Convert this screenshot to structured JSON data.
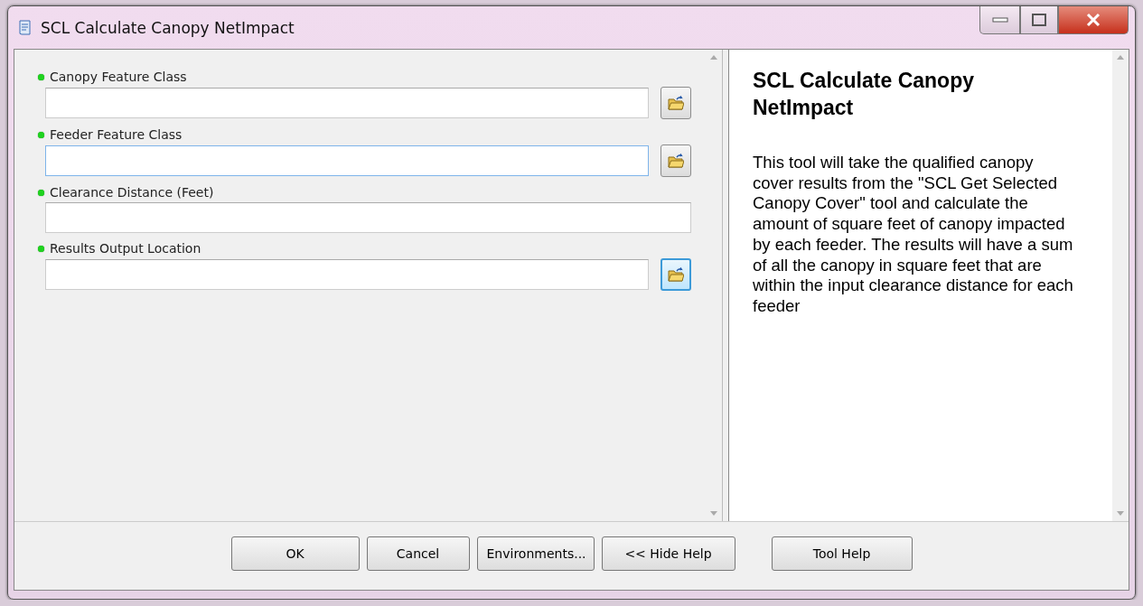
{
  "window": {
    "title": "SCL Calculate Canopy NetImpact"
  },
  "parameters": [
    {
      "label": "Canopy Feature Class",
      "kind": "browse",
      "focused": false,
      "button_highlighted": false
    },
    {
      "label": "Feeder Feature Class",
      "kind": "browse",
      "focused": true,
      "button_highlighted": false
    },
    {
      "label": "Clearance Distance (Feet)",
      "kind": "text",
      "focused": false
    },
    {
      "label": "Results Output Location",
      "kind": "browse",
      "focused": false,
      "button_highlighted": true
    }
  ],
  "help": {
    "title": "SCL Calculate Canopy NetImpact",
    "text": "This tool will take the qualified canopy cover results from the \"SCL Get Selected Canopy Cover\" tool and calculate the amount of square feet of canopy impacted by each feeder. The results will have a sum of all the canopy in square feet that are within the input clearance distance for each feeder"
  },
  "buttons": [
    "OK",
    "Cancel",
    "Environments...",
    "<< Hide Help",
    "Tool Help"
  ]
}
